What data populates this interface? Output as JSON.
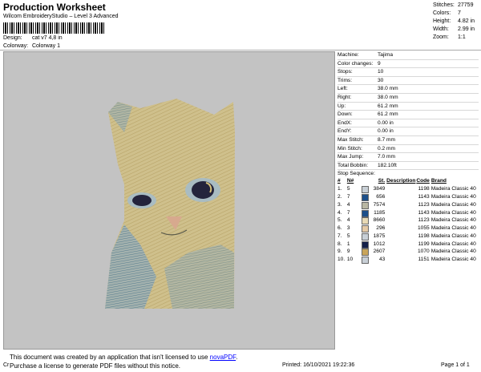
{
  "header": {
    "title": "Production Worksheet",
    "subtitle": "Wilcom EmbroideryStudio – Level 3 Advanced",
    "design_label": "Design:",
    "design_value": "cat v7 4,8 in",
    "colorway_label": "Colorway:",
    "colorway_value": "Colorway 1"
  },
  "summary": [
    {
      "label": "Stitches:",
      "value": "27759"
    },
    {
      "label": "Colors:",
      "value": "7"
    },
    {
      "label": "Height:",
      "value": "4.82 in"
    },
    {
      "label": "Width:",
      "value": "2.99 in"
    },
    {
      "label": "Zoom:",
      "value": "1:1"
    }
  ],
  "properties": [
    {
      "label": "Machine:",
      "value": "Tajima"
    },
    {
      "label": "Color changes:",
      "value": "9"
    },
    {
      "label": "Stops:",
      "value": "10"
    },
    {
      "label": "Trims:",
      "value": "30"
    },
    {
      "label": "Left:",
      "value": "38.0 mm"
    },
    {
      "label": "Right:",
      "value": "38.0 mm"
    },
    {
      "label": "Up:",
      "value": "61.2 mm"
    },
    {
      "label": "Down:",
      "value": "61.2 mm"
    },
    {
      "label": "EndX:",
      "value": "0.00 in"
    },
    {
      "label": "EndY:",
      "value": "0.00 in"
    },
    {
      "label": "Max Stitch:",
      "value": "8.7 mm"
    },
    {
      "label": "Min Stitch:",
      "value": "0.2 mm"
    },
    {
      "label": "Max Jump:",
      "value": "7.0 mm"
    },
    {
      "label": "Total Bobbin:",
      "value": "182.10ft"
    }
  ],
  "stop_sequence": {
    "title": "Stop Sequence:",
    "headers": {
      "idx": "#",
      "n": "N#",
      "st": "St.",
      "desc": "Description",
      "code": "Code",
      "brand": "Brand"
    },
    "rows": [
      {
        "idx": "1.",
        "n": "5",
        "color": "#c8cfd6",
        "st": "3849",
        "desc": "",
        "code": "1198",
        "brand": "Madeira Classic 40"
      },
      {
        "idx": "2.",
        "n": "7",
        "color": "#1d4f8a",
        "st": "656",
        "desc": "",
        "code": "1143",
        "brand": "Madeira Classic 40"
      },
      {
        "idx": "3.",
        "n": "4",
        "color": "#b9b7a3",
        "st": "7574",
        "desc": "",
        "code": "1123",
        "brand": "Madeira Classic 40"
      },
      {
        "idx": "4.",
        "n": "7",
        "color": "#1d4f8a",
        "st": "1185",
        "desc": "",
        "code": "1143",
        "brand": "Madeira Classic 40"
      },
      {
        "idx": "5.",
        "n": "4",
        "color": "#e8d9b4",
        "st": "8660",
        "desc": "",
        "code": "1123",
        "brand": "Madeira Classic 40"
      },
      {
        "idx": "6.",
        "n": "3",
        "color": "#e4c9a6",
        "st": "296",
        "desc": "",
        "code": "1055",
        "brand": "Madeira Classic 40"
      },
      {
        "idx": "7.",
        "n": "5",
        "color": "#c8cfd6",
        "st": "1875",
        "desc": "",
        "code": "1198",
        "brand": "Madeira Classic 40"
      },
      {
        "idx": "8.",
        "n": "1",
        "color": "#14204a",
        "st": "1012",
        "desc": "",
        "code": "1199",
        "brand": "Madeira Classic 40"
      },
      {
        "idx": "9.",
        "n": "9",
        "color": "#c9a55a",
        "st": "2607",
        "desc": "",
        "code": "1070",
        "brand": "Madeira Classic 40"
      },
      {
        "idx": "10.",
        "n": "10",
        "color": "#c8cfd6",
        "st": "43",
        "desc": "",
        "code": "1151",
        "brand": "Madeira Classic 40"
      }
    ]
  },
  "notice": {
    "line1_prefix": "This document was created by an application that isn't licensed to use ",
    "link": "novaPDF",
    "line1_suffix": ".",
    "line2": "Purchase a license to generate PDF files without this notice."
  },
  "footer": {
    "left": "Cr",
    "printed": "Printed: 16/10/2021 19:22:36",
    "page": "Page 1 of 1"
  }
}
